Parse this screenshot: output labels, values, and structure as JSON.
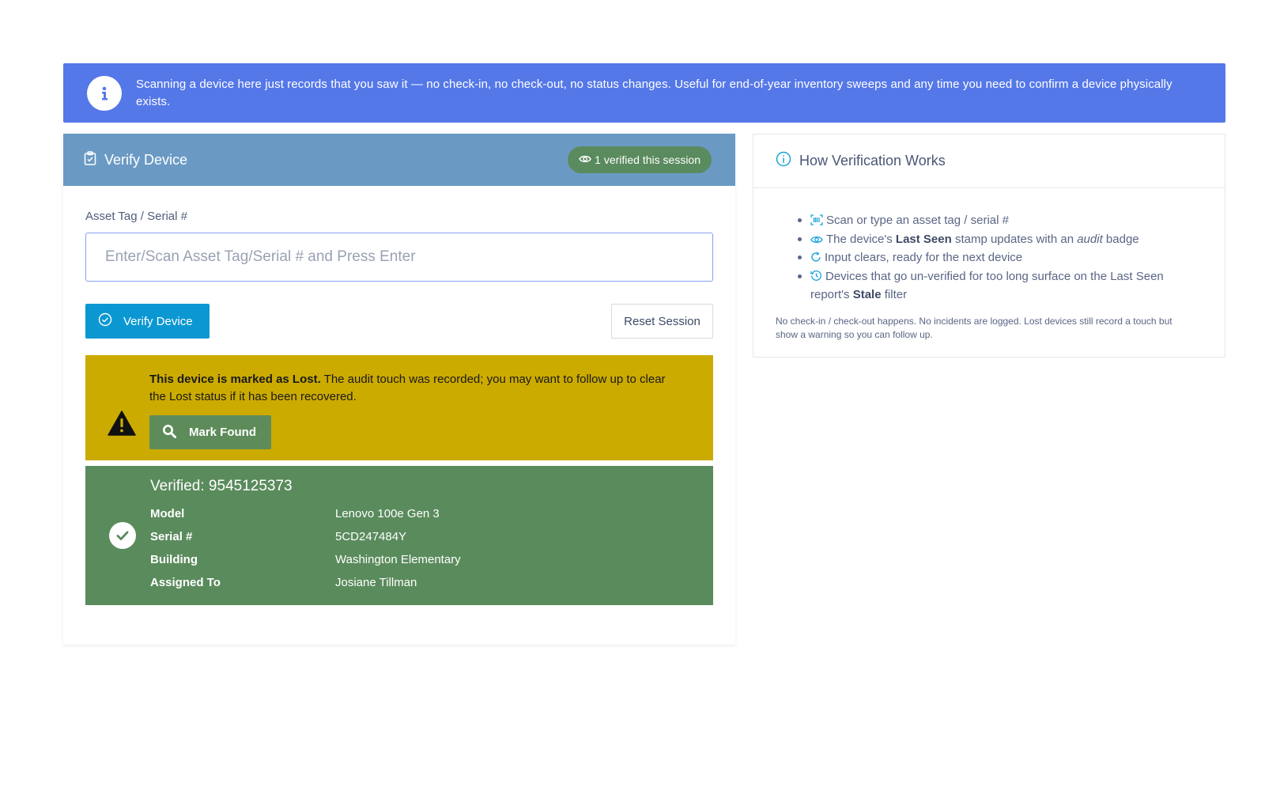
{
  "banner": {
    "icon": "info-circle-icon",
    "text": "Scanning a device here just records that you saw it — no check-in, no check-out, no status changes. Useful for end-of-year inventory sweeps and any time you need to confirm a device physically exists."
  },
  "verify_card": {
    "title": "Verify Device",
    "title_icon": "clipboard-check-icon",
    "session_badge": "1 verified this session",
    "field_label": "Asset Tag / Serial #",
    "input_value": "",
    "input_placeholder": "Enter/Scan Asset Tag/Serial # and Press Enter",
    "verify_button": "Verify Device",
    "reset_button": "Reset Session",
    "lost_alert": {
      "bold": "This device is marked as Lost.",
      "message": " The audit touch was recorded; you may want to follow up to clear the Lost status if it has been recovered.",
      "button": "Mark Found"
    },
    "verified": {
      "title": "Verified: 9545125373",
      "rows": [
        {
          "label": "Model",
          "value": "Lenovo 100e Gen 3"
        },
        {
          "label": "Serial #",
          "value": "5CD247484Y"
        },
        {
          "label": "Building",
          "value": "Washington Elementary"
        },
        {
          "label": "Assigned To",
          "value": "Josiane Tillman"
        }
      ]
    }
  },
  "how_card": {
    "title": "How Verification Works",
    "steps": {
      "s1": "Scan or type an asset tag / serial #",
      "s2_a": "The device's ",
      "s2_b": "Last Seen",
      "s2_c": " stamp updates with an ",
      "s2_d": "audit",
      "s2_e": " badge",
      "s3": "Input clears, ready for the next device",
      "s4_a": "Devices that go un-verified for too long surface on the Last Seen report's ",
      "s4_b": "Stale",
      "s4_c": " filter"
    },
    "note": "No check-in / check-out happens. No incidents are logged. Lost devices still record a touch but show a warning so you can follow up."
  },
  "colors": {
    "banner": "#5578e8",
    "card_header": "#6a9ac4",
    "primary_button": "#0b97d2",
    "lost_alert": "#ccab00",
    "success": "#5a8b5c",
    "accent_icon": "#1aa3d9"
  }
}
